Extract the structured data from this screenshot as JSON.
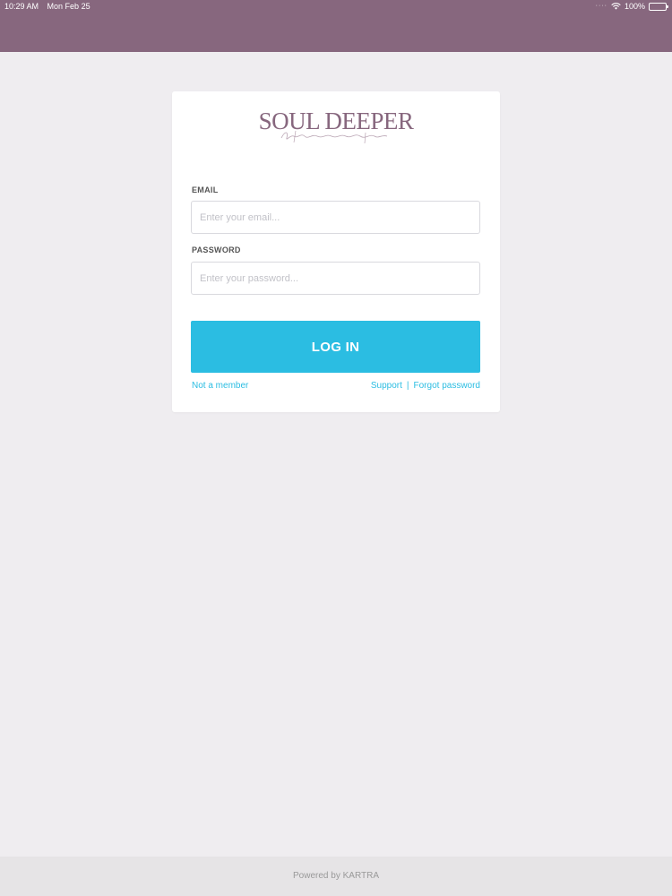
{
  "status_bar": {
    "time": "10:29 AM",
    "date": "Mon Feb 25",
    "battery": "100%",
    "icons": [
      "wifi-icon",
      "battery-icon"
    ]
  },
  "brand": {
    "logo_text": "SOUL DEEPER",
    "primary_color": "#87677e",
    "accent_color": "#2bbde2"
  },
  "form": {
    "email_label": "EMAIL",
    "email_placeholder": "Enter your email...",
    "email_value": "",
    "password_label": "PASSWORD",
    "password_placeholder": "Enter your password...",
    "password_value": "",
    "login_label": "LOG IN"
  },
  "links": {
    "not_member": "Not a member",
    "support": "Support",
    "separator": "|",
    "forgot": "Forgot password"
  },
  "footer": {
    "powered_by": "Powered by KARTRA"
  }
}
